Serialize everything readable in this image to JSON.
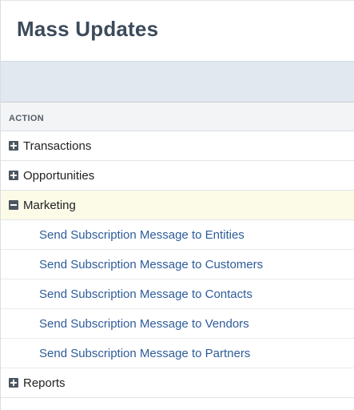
{
  "page": {
    "title": "Mass Updates"
  },
  "table": {
    "column_header": "ACTION"
  },
  "categories": [
    {
      "label": "Transactions",
      "state": "collapsed",
      "icon": "plus-icon"
    },
    {
      "label": "Opportunities",
      "state": "collapsed",
      "icon": "plus-icon"
    },
    {
      "label": "Marketing",
      "state": "expanded",
      "icon": "minus-icon"
    },
    {
      "label": "Reports",
      "state": "collapsed",
      "icon": "plus-icon"
    }
  ],
  "marketing_actions": [
    "Send Subscription Message to Entities",
    "Send Subscription Message to Customers",
    "Send Subscription Message to Contacts",
    "Send Subscription Message to Vendors",
    "Send Subscription Message to Partners"
  ],
  "colors": {
    "title": "#3c4b5b",
    "link": "#2e5c99",
    "expanded_row_bg": "#fbfbe8",
    "header_band": "#e2e8f0"
  }
}
